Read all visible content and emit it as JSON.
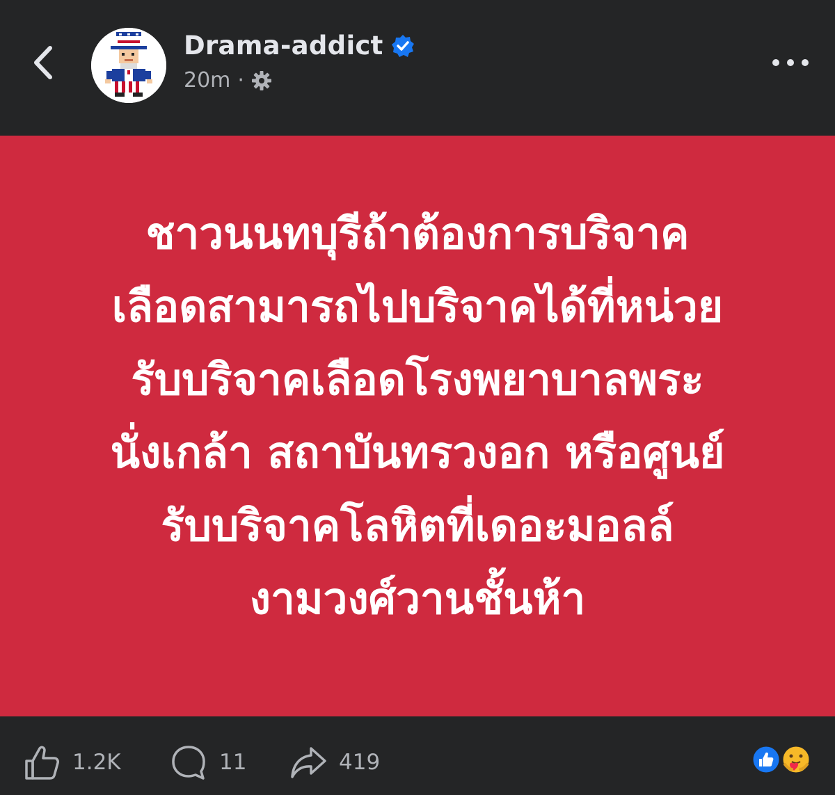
{
  "header": {
    "author_name": "Drama-addict",
    "timestamp": "20m",
    "meta_separator": "·",
    "privacy_icon": "gear-icon",
    "verified_icon": "verified-badge-icon"
  },
  "post": {
    "lines": [
      "ชาวนนทบุรีถ้าต้องการบริจาค",
      "เลือดสามารถไปบริจาคได้ที่หน่วย",
      "รับบริจาคเลือดโรงพยาบาลพระ",
      "นั่งเกล้า สถาบันทรวงอก หรือศูนย์",
      "รับบริจาคโลหิตที่เดอะมอลล์",
      "งามวงศ์วานชั้นห้า"
    ],
    "background_color": "#cf2a3f"
  },
  "actions": {
    "likes": "1.2K",
    "comments": "11",
    "shares": "419"
  },
  "colors": {
    "bar": "#242526",
    "verified": "#1877f2",
    "text_secondary": "#b0b3b8"
  }
}
